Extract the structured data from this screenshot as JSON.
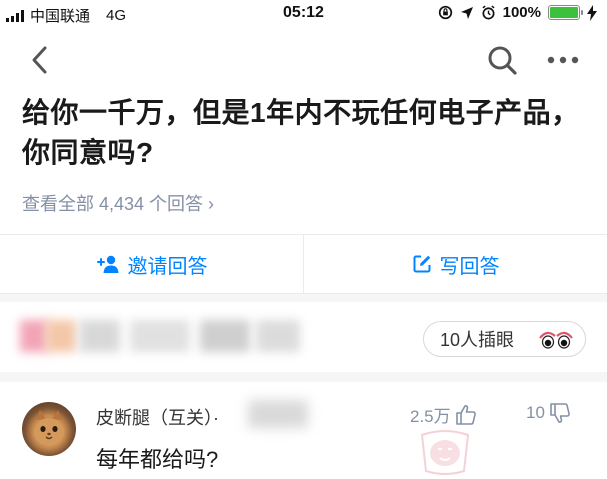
{
  "status_bar": {
    "carrier": "中国联通",
    "network": "4G",
    "time": "05:12",
    "battery_percent": "100%",
    "battery_level": 1.0,
    "icons": [
      "lock-rotation-icon",
      "location-icon",
      "alarm-icon",
      "charging-icon"
    ]
  },
  "nav": {
    "back_icon": "chevron-left-icon",
    "search_icon": "search-icon",
    "more_icon": "more-icon"
  },
  "question": {
    "title": "给你一千万，但是1年内不玩任何电子产品，你同意吗?",
    "view_all": "查看全部 4,434 个回答 ›"
  },
  "actions": {
    "invite_label": "邀请回答",
    "write_label": "写回答",
    "accent_color": "#0084ff"
  },
  "peek": {
    "label": "10人插眼"
  },
  "comment": {
    "author": "皮断腿（互关）·",
    "text": "每年都给吗?",
    "likes": "2.5万",
    "dislikes": "10"
  }
}
